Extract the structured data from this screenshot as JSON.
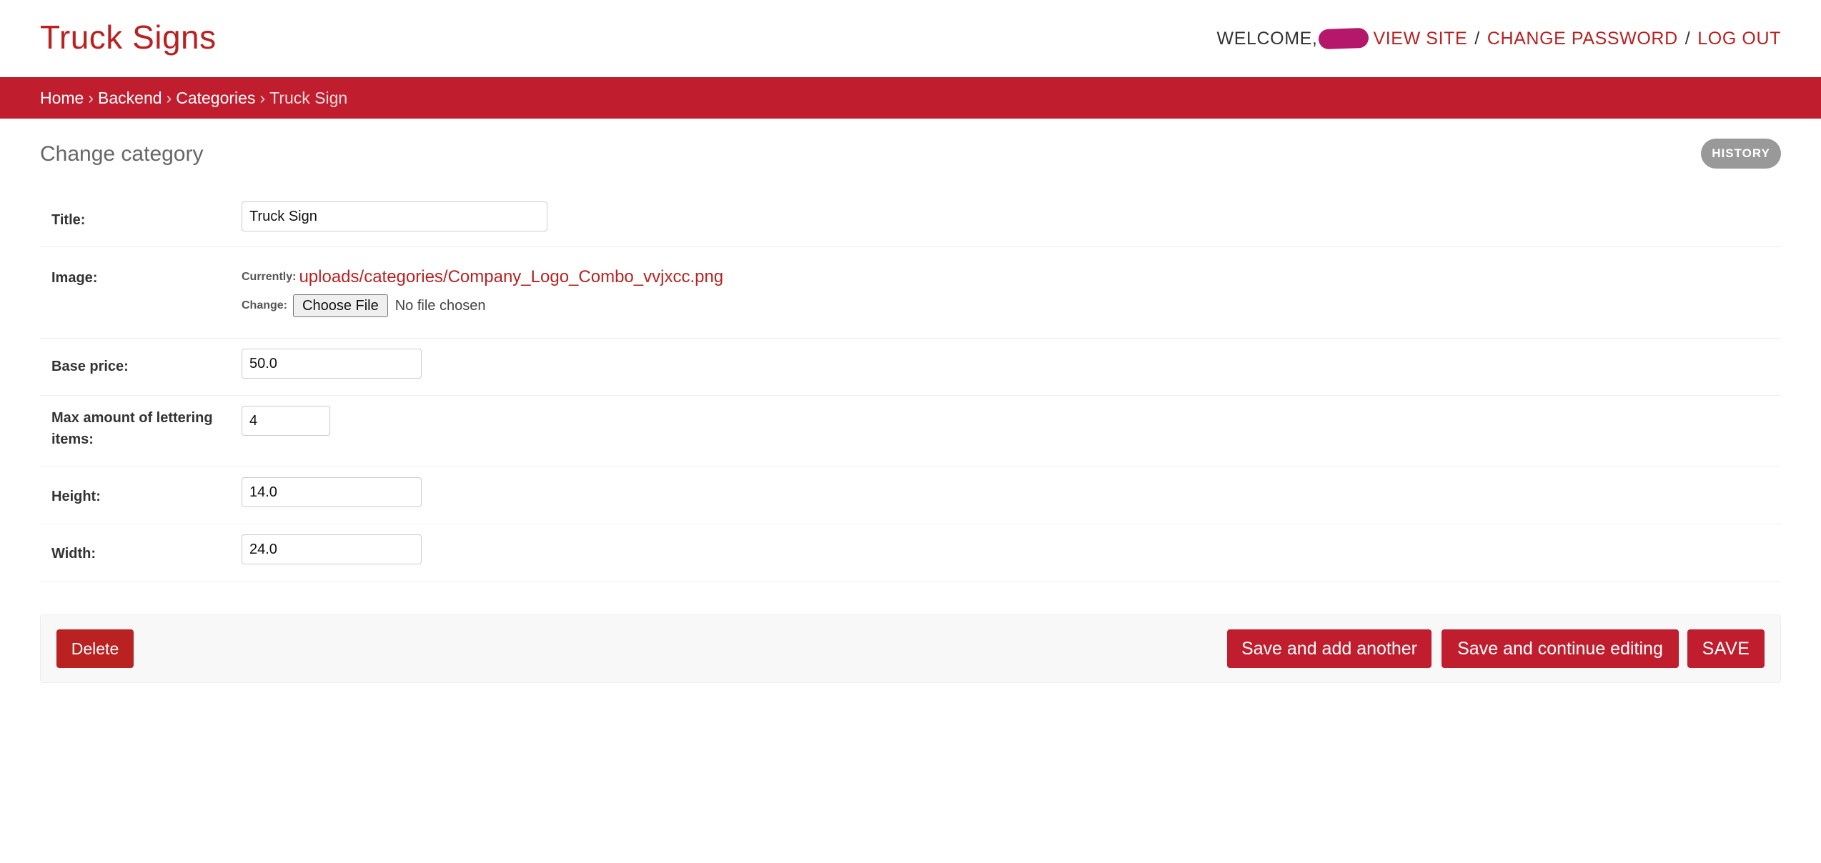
{
  "header": {
    "brand": "Truck Signs",
    "welcome": "WELCOME,",
    "view_site": "VIEW SITE",
    "change_password": "CHANGE PASSWORD",
    "log_out": "LOG OUT",
    "separator": "/"
  },
  "breadcrumbs": {
    "items": [
      "Home",
      "Backend",
      "Categories"
    ],
    "current": "Truck Sign",
    "arrow": "›"
  },
  "page": {
    "title": "Change category",
    "history": "HISTORY"
  },
  "form": {
    "title_label": "Title:",
    "title_value": "Truck Sign",
    "image_label": "Image:",
    "image_currently_label": "Currently:",
    "image_currently_link": "uploads/categories/Company_Logo_Combo_vvjxcc.png",
    "image_change_label": "Change:",
    "choose_file": "Choose File",
    "no_file": "No file chosen",
    "base_price_label": "Base price:",
    "base_price_value": "50.0",
    "max_label": "Max amount of lettering items:",
    "max_value": "4",
    "height_label": "Height:",
    "height_value": "14.0",
    "width_label": "Width:",
    "width_value": "24.0"
  },
  "submit": {
    "delete": "Delete",
    "save_add_another": "Save and add another",
    "save_continue": "Save and continue editing",
    "save": "SAVE"
  },
  "colors": {
    "accent": "#ba2121",
    "breadcrumb_bar": "#c01e2e",
    "username_redaction": "#b5176b"
  }
}
